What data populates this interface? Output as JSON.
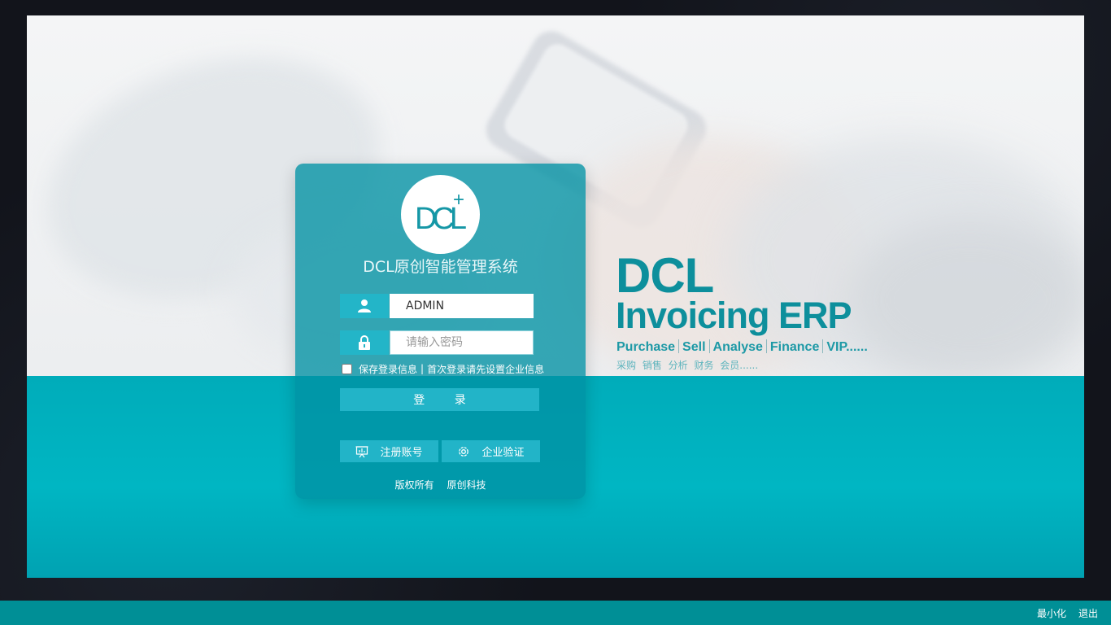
{
  "login": {
    "system_title": "DCL原创智能管理系统",
    "username_value": "ADMIN",
    "password_placeholder": "请输入密码",
    "remember_label": "保存登录信息",
    "remember_separator": "|",
    "first_login_link": "首次登录请先设置企业信息",
    "login_button": "登 录",
    "register_button": "注册账号",
    "verify_button": "企业验证",
    "copyright_left": "版权所有",
    "copyright_right": "原创科技"
  },
  "logo": {
    "text": "DCL",
    "plus": "+"
  },
  "brand": {
    "headline": "DCL",
    "subheadline": "Invoicing ERP",
    "tags": [
      "Purchase",
      "Sell",
      "Analyse",
      "Finance",
      "VIP......"
    ],
    "tags_cn": "采购  销售  分析  财务  会员......"
  },
  "window_actions": {
    "minimize": "最小化",
    "exit": "退出"
  },
  "colors": {
    "teal": "#00b2bf",
    "panel": "#0091a3",
    "brand_text": "#0d8f9c",
    "bottom_bar": "#008f96"
  },
  "icons": {
    "user": "user-icon",
    "lock": "lock-icon",
    "register": "presentation-icon",
    "verify": "gear-icon"
  }
}
